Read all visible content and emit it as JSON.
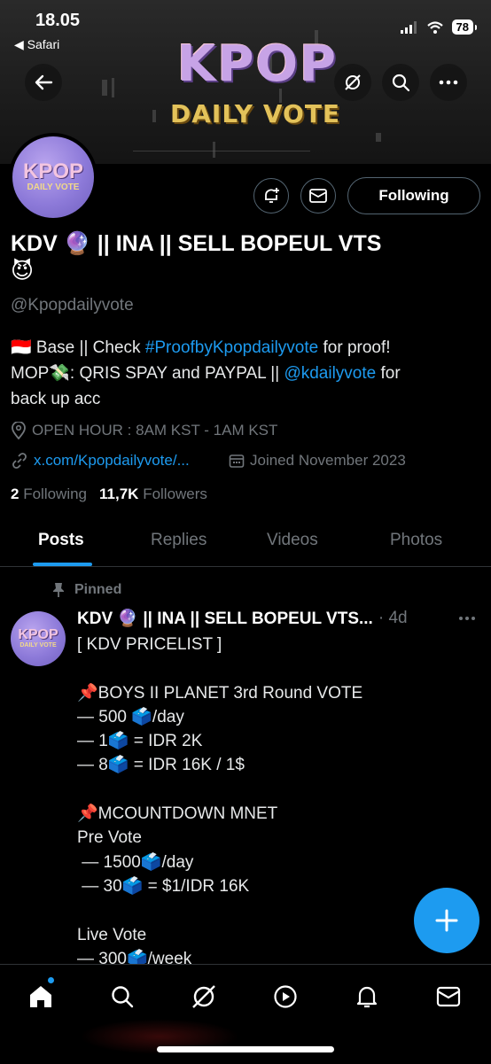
{
  "status_bar": {
    "time": "18.05",
    "back_app": "Safari",
    "battery": "78"
  },
  "banner": {
    "logo_main": "KPOP",
    "logo_sub": "DAILY VOTE"
  },
  "avatar": {
    "line1": "KPOP",
    "line2": "DAILY VOTE"
  },
  "profile": {
    "following_button": "Following",
    "name_line1": "KDV 🔮 || INA || SELL BOPEUL VTS",
    "name_line2": "😈",
    "handle": "@Kpopdailyvote",
    "bio_prefix": "🇮🇩  Base || Check ",
    "bio_hashtag": "#ProofbyKpopdailyvote",
    "bio_mid": " for proof!",
    "bio_line2_prefix": "MOP💸: QRIS SPAY and PAYPAL || ",
    "bio_mention": "@kdailyvote",
    "bio_line2_suffix": " for",
    "bio_line3": "back up acc",
    "location": "OPEN HOUR : 8AM KST - 1AM KST",
    "website": "x.com/Kpopdailyvote/...",
    "joined": "Joined November 2023",
    "following_count": "2",
    "following_label": "Following",
    "followers_count": "11,7K",
    "followers_label": "Followers"
  },
  "tabs": [
    {
      "label": "Posts",
      "active": true
    },
    {
      "label": "Replies",
      "active": false
    },
    {
      "label": "Videos",
      "active": false
    },
    {
      "label": "Photos",
      "active": false
    }
  ],
  "post": {
    "pinned_label": "Pinned",
    "author": "KDV 🔮 || INA || SELL BOPEUL VTS...",
    "time": "· 4d",
    "lines": [
      "[ KDV PRICELIST ]",
      "",
      "📌BOYS II PLANET 3rd Round VOTE",
      "— 500 🗳️/day",
      "— 1🗳️ = IDR 2K",
      "— 8🗳️ = IDR 16K / 1$",
      "",
      "📌MCOUNTDOWN MNET",
      "Pre Vote",
      " — 1500🗳️/day",
      " — 30🗳️ = $1/IDR 16K",
      "",
      "Live Vote",
      "— 300🗳️/week"
    ]
  },
  "bottom_nav": [
    "home-icon",
    "search-icon",
    "grok-icon",
    "video-icon",
    "notifications-icon",
    "messages-icon"
  ],
  "colors": {
    "accent": "#1d9bf0",
    "muted": "#71767b",
    "background": "#000000"
  }
}
